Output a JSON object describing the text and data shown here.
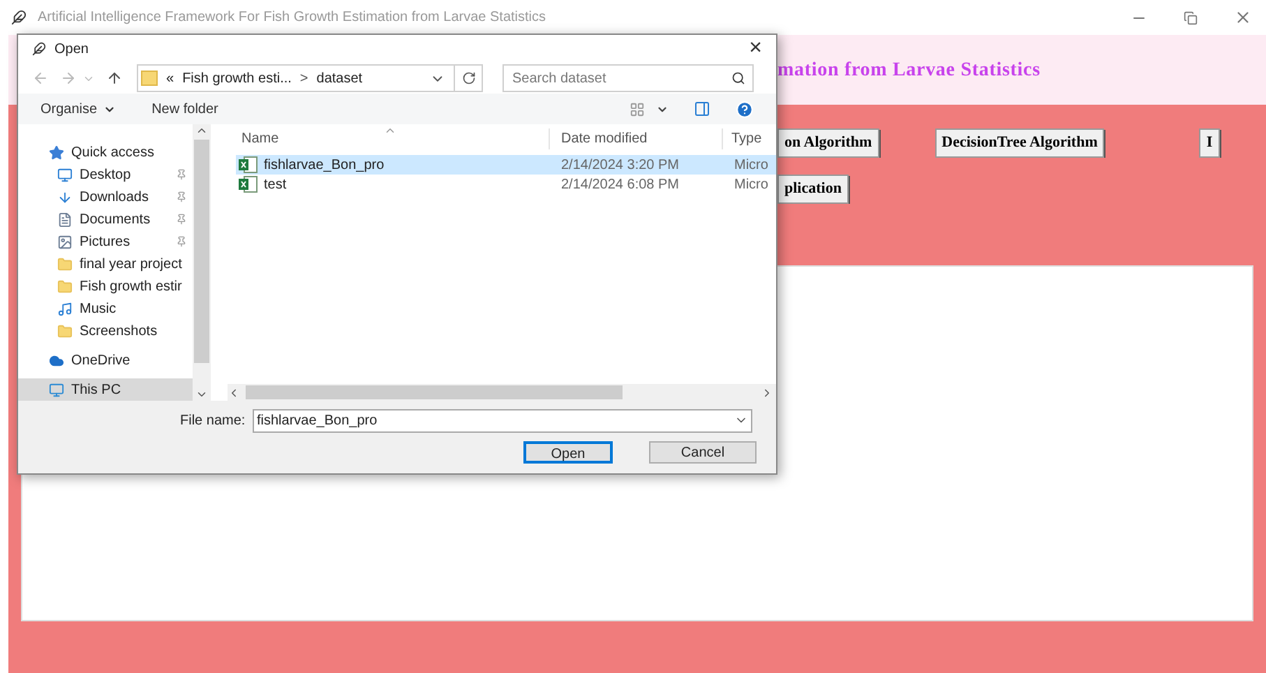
{
  "app_window": {
    "title": "Artificial Intelligence Framework For Fish Growth Estimation from Larvae Statistics",
    "heading": "mation from Larvae Statistics",
    "button_rows": [
      [
        "on Algorithm",
        "DecisionTree Algorithm",
        "I"
      ],
      [
        "plication"
      ]
    ]
  },
  "dialog": {
    "title": "Open",
    "close": "×",
    "address": {
      "prefix": "«",
      "crumbs": [
        "Fish growth esti...",
        "dataset"
      ],
      "separator": ">"
    },
    "search": {
      "placeholder": "Search dataset"
    },
    "toolbar": {
      "organise": "Organise",
      "new_folder": "New folder"
    },
    "nav": [
      {
        "label": "Quick access",
        "pinned": false,
        "selected": false
      },
      {
        "label": "Desktop",
        "pinned": true,
        "selected": false
      },
      {
        "label": "Downloads",
        "pinned": true,
        "selected": false
      },
      {
        "label": "Documents",
        "pinned": true,
        "selected": false
      },
      {
        "label": "Pictures",
        "pinned": true,
        "selected": false
      },
      {
        "label": "final year project",
        "pinned": false,
        "selected": false
      },
      {
        "label": "Fish growth estir",
        "pinned": false,
        "selected": false
      },
      {
        "label": "Music",
        "pinned": false,
        "selected": false
      },
      {
        "label": "Screenshots",
        "pinned": false,
        "selected": false
      },
      {
        "label": "OneDrive",
        "pinned": false,
        "selected": false
      },
      {
        "label": "This PC",
        "pinned": false,
        "selected": true
      }
    ],
    "columns": [
      "Name",
      "Date modified",
      "Type"
    ],
    "files": [
      {
        "name": "fishlarvae_Bon_pro",
        "date": "2/14/2024 3:20 PM",
        "type": "Micro",
        "selected": true
      },
      {
        "name": "test",
        "date": "2/14/2024 6:08 PM",
        "type": "Micro",
        "selected": false
      }
    ],
    "file_name_label": "File name:",
    "file_name": "fishlarvae_Bon_pro",
    "buttons": [
      {
        "label": "Open",
        "kind": "primary"
      },
      {
        "label": "Cancel",
        "kind": "secondary"
      }
    ]
  }
}
